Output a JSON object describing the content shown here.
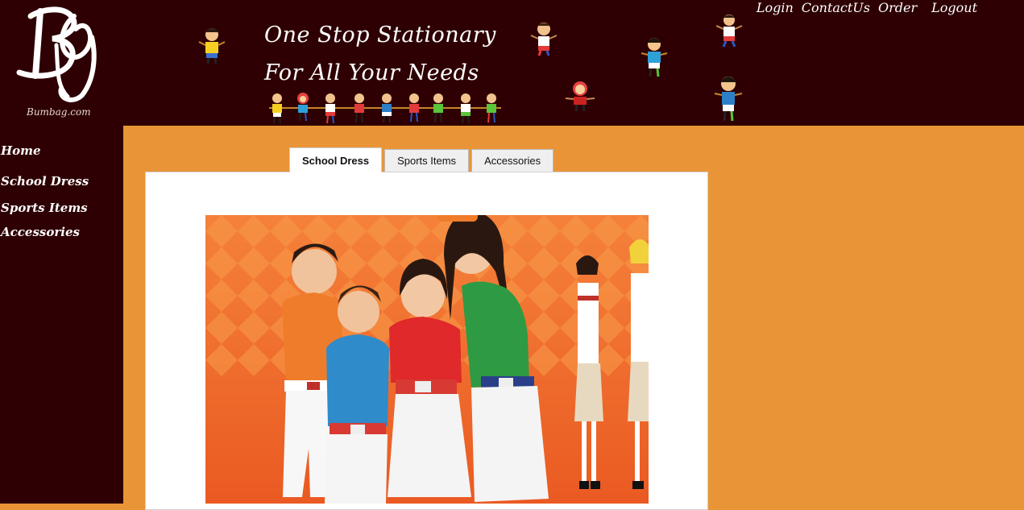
{
  "logo": {
    "caption": "Bumbag.com"
  },
  "header": {
    "tagline_line1": "One Stop Stationary",
    "tagline_line2": "For All Your Needs"
  },
  "topnav": [
    "Login",
    "ContactUs",
    "Order",
    "Logout"
  ],
  "sidebar": {
    "items": [
      "Home",
      "School Dress",
      "Sports Items",
      "Accessories"
    ]
  },
  "tabs": [
    "School Dress",
    "Sports Items",
    "Accessories"
  ],
  "colors": {
    "header_bg": "#2e0003",
    "page_bg": "#e99537",
    "panel_bg": "#ffffff"
  }
}
